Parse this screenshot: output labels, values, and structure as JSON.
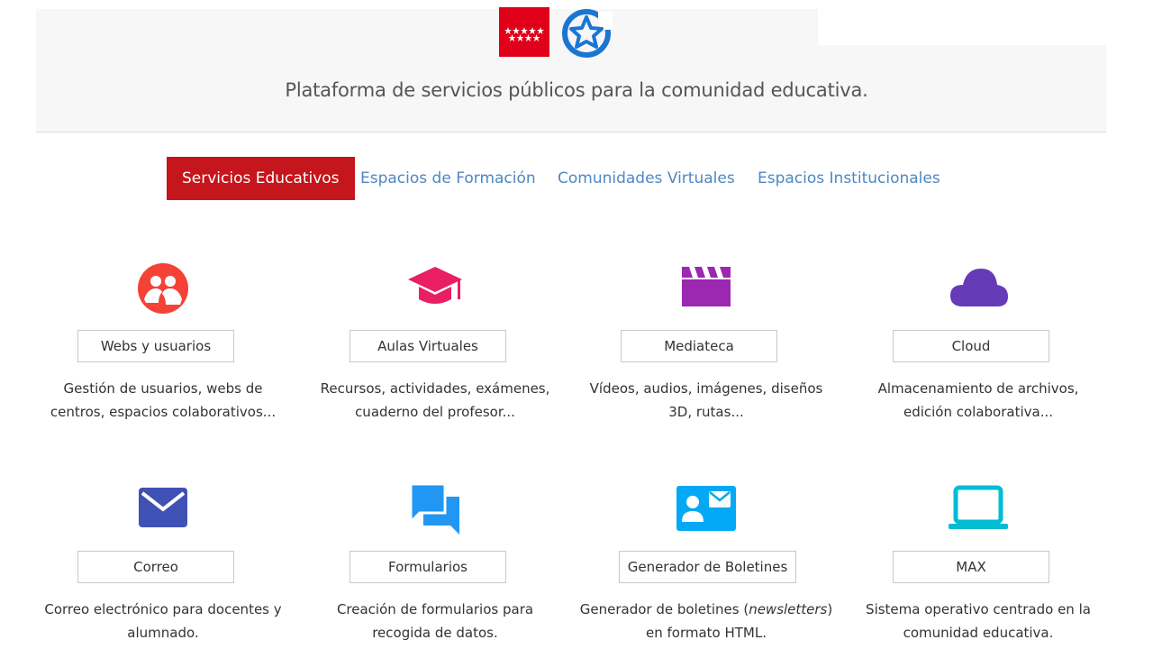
{
  "header": {
    "tagline": "Plataforma de servicios públicos para la comunidad educativa."
  },
  "tabs": [
    {
      "label": "Servicios Educativos",
      "active": true
    },
    {
      "label": "Espacios de Formación",
      "active": false
    },
    {
      "label": "Comunidades Virtuales",
      "active": false
    },
    {
      "label": "Espacios Institucionales",
      "active": false
    }
  ],
  "services": [
    {
      "icon": "users-icon",
      "color": "#f44336",
      "button": "Webs y usuarios",
      "desc_1": "Gestión de usuarios, webs de",
      "desc_2": "centros, espacios colaborativos..."
    },
    {
      "icon": "graduation-cap-icon",
      "color": "#e91e63",
      "button": "Aulas Virtuales",
      "desc_1": "Recursos, actividades, exámenes,",
      "desc_2": "cuaderno del profesor..."
    },
    {
      "icon": "clapperboard-icon",
      "color": "#9c27b0",
      "button": "Mediateca",
      "desc_1": "Vídeos, audios, imágenes, diseños",
      "desc_2": "3D, rutas..."
    },
    {
      "icon": "cloud-icon",
      "color": "#673ab7",
      "button": "Cloud",
      "desc_1": "Almacenamiento de archivos,",
      "desc_2": "edición colaborativa..."
    },
    {
      "icon": "mail-icon",
      "color": "#3f51b5",
      "button": "Correo",
      "desc_1": "Correo electrónico para docentes y",
      "desc_2": "alumnado."
    },
    {
      "icon": "forum-icon",
      "color": "#2196f3",
      "button": "Formularios",
      "desc_1": "Creación de formularios para",
      "desc_2": "recogida de datos."
    },
    {
      "icon": "contact-mail-icon",
      "color": "#03a9f4",
      "button": "Generador de Boletines",
      "desc_1_pre": "Generador de boletines (",
      "desc_1_em": "newsletters",
      "desc_1_post": ")",
      "desc_2": "en formato HTML."
    },
    {
      "icon": "laptop-icon",
      "color": "#00bcd4",
      "button": "MAX",
      "desc_1": "Sistema operativo centrado en la",
      "desc_2": "comunidad educativa."
    }
  ]
}
